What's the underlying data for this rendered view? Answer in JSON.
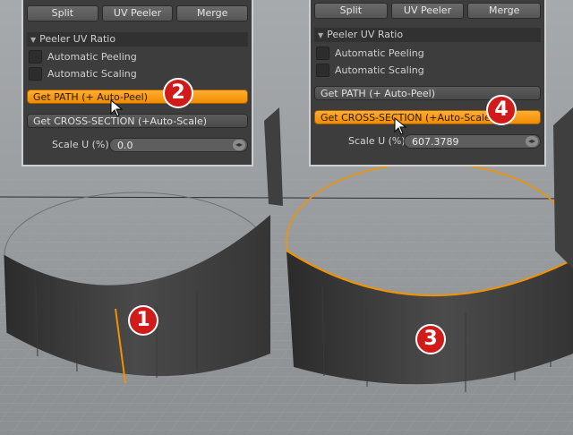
{
  "panels": [
    {
      "buttons": {
        "split": "Split",
        "uv_peeler": "UV Peeler",
        "merge": "Merge"
      },
      "section_title": "Peeler UV Ratio",
      "auto_peeling": "Automatic Peeling",
      "auto_scaling": "Automatic Scaling",
      "get_path": "Get PATH (+ Auto-Peel)",
      "get_cross": "Get CROSS-SECTION (+Auto-Scale)",
      "scale_label": "Scale U (%)",
      "scale_value": "0.0",
      "active": "get_path"
    },
    {
      "buttons": {
        "split": "Split",
        "uv_peeler": "UV Peeler",
        "merge": "Merge"
      },
      "section_title": "Peeler UV Ratio",
      "auto_peeling": "Automatic Peeling",
      "auto_scaling": "Automatic Scaling",
      "get_path": "Get PATH (+ Auto-Peel)",
      "get_cross": "Get CROSS-SECTION (+Auto-Scale)",
      "scale_label": "Scale U (%)",
      "scale_value": "607.3789",
      "active": "get_cross"
    }
  ],
  "badges": [
    "1",
    "2",
    "3",
    "4"
  ],
  "colors": {
    "accent": "#f29200",
    "badge": "#d11b1b",
    "panel": "#3d3d3d",
    "grid": "#8d9093"
  },
  "icons": [
    "triangle-down-icon",
    "spinner-icon",
    "mouse-cursor-icon"
  ]
}
